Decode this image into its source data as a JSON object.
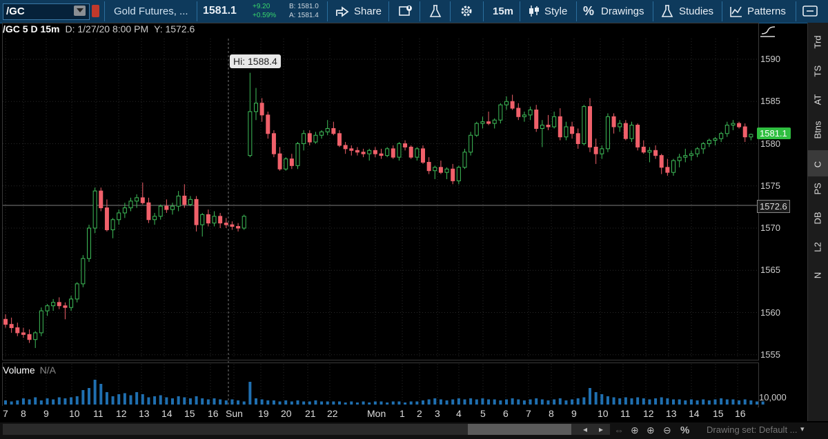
{
  "toolbar": {
    "symbol": "/GC",
    "description": "Gold Futures, ...",
    "last": "1581.1",
    "change": "+9.20",
    "change_pct": "+0.59%",
    "bid": "B: 1581.0",
    "ask": "A: 1581.4",
    "share": "Share",
    "timeframe": "15m",
    "style": "Style",
    "drawings": "Drawings",
    "studies": "Studies",
    "patterns": "Patterns"
  },
  "chart_info": {
    "title": "/GC 5 D 15m",
    "date": "D: 1/27/20 8:00 PM",
    "y": "Y: 1572.6"
  },
  "annotations": {
    "hi": "Hi: 1588.4",
    "last_price": "1581.1",
    "crosshair_price": "1572.6"
  },
  "volume": {
    "label": "Volume",
    "value": "N/A",
    "axis_label": "10,000"
  },
  "side_tabs": [
    "Trd",
    "TS",
    "AT",
    "Btns",
    "C",
    "PS",
    "DB",
    "L2",
    "N"
  ],
  "side_active": "C",
  "drawing_set": "Drawing set: Default ...",
  "colors": {
    "up": "#3fbf5a",
    "down": "#f0606a",
    "volume": "#1f6fb0",
    "toolbar_bg": "#0e3a5c",
    "last_badge": "#2fbf40"
  },
  "chart_data": {
    "type": "candlestick",
    "title": "/GC 5 D 15m",
    "ylim": [
      1554,
      1593
    ],
    "y_ticks": [
      1555,
      1560,
      1565,
      1570,
      1575,
      1580,
      1585,
      1590
    ],
    "x_ticks": [
      "7",
      "8",
      "9",
      "10",
      "11",
      "12",
      "13",
      "14",
      "15",
      "16",
      "Sun",
      "19",
      "20",
      "21",
      "22",
      "Mon",
      "1",
      "2",
      "3",
      "4",
      "5",
      "6",
      "7",
      "8",
      "9",
      "10",
      "11",
      "12",
      "13",
      "14",
      "15",
      "16"
    ],
    "session_break_index": 44,
    "candles": [
      [
        1559.2,
        1559.8,
        1558.2,
        1558.6
      ],
      [
        1558.6,
        1559.4,
        1557.6,
        1558.2
      ],
      [
        1558.2,
        1558.8,
        1557.2,
        1557.6
      ],
      [
        1557.6,
        1558.2,
        1557.0,
        1557.4
      ],
      [
        1557.4,
        1558.0,
        1556.4,
        1556.8
      ],
      [
        1556.8,
        1557.8,
        1555.8,
        1557.6
      ],
      [
        1557.6,
        1560.6,
        1557.2,
        1560.2
      ],
      [
        1560.2,
        1561.0,
        1559.6,
        1560.8
      ],
      [
        1560.8,
        1561.6,
        1560.2,
        1561.2
      ],
      [
        1561.2,
        1561.8,
        1560.4,
        1560.8
      ],
      [
        1560.8,
        1561.2,
        1559.2,
        1560.6
      ],
      [
        1560.6,
        1562.0,
        1560.2,
        1561.6
      ],
      [
        1561.6,
        1563.6,
        1561.2,
        1563.4
      ],
      [
        1563.4,
        1566.8,
        1563.0,
        1566.4
      ],
      [
        1566.4,
        1570.4,
        1566.0,
        1570.0
      ],
      [
        1570.0,
        1574.8,
        1569.4,
        1574.4
      ],
      [
        1574.4,
        1574.8,
        1572.0,
        1572.4
      ],
      [
        1572.4,
        1573.4,
        1569.6,
        1569.8
      ],
      [
        1569.8,
        1571.2,
        1568.8,
        1571.0
      ],
      [
        1571.0,
        1572.2,
        1570.4,
        1571.8
      ],
      [
        1571.8,
        1573.0,
        1571.2,
        1572.4
      ],
      [
        1572.4,
        1573.6,
        1572.0,
        1573.2
      ],
      [
        1573.2,
        1574.0,
        1572.4,
        1573.6
      ],
      [
        1573.6,
        1575.4,
        1572.8,
        1573.0
      ],
      [
        1573.0,
        1573.6,
        1570.6,
        1571.0
      ],
      [
        1571.0,
        1571.8,
        1570.4,
        1571.4
      ],
      [
        1571.4,
        1572.8,
        1571.0,
        1572.6
      ],
      [
        1572.6,
        1573.4,
        1571.8,
        1572.2
      ],
      [
        1572.2,
        1573.0,
        1571.6,
        1572.6
      ],
      [
        1572.6,
        1574.4,
        1572.0,
        1573.8
      ],
      [
        1573.8,
        1575.2,
        1572.4,
        1572.8
      ],
      [
        1572.8,
        1573.8,
        1572.6,
        1573.4
      ],
      [
        1573.4,
        1573.8,
        1569.6,
        1570.4
      ],
      [
        1570.4,
        1571.8,
        1569.0,
        1571.6
      ],
      [
        1571.6,
        1572.2,
        1570.2,
        1570.6
      ],
      [
        1570.6,
        1572.0,
        1570.2,
        1571.4
      ],
      [
        1571.4,
        1571.8,
        1570.0,
        1570.6
      ],
      [
        1570.6,
        1571.2,
        1570.0,
        1570.4
      ],
      [
        1570.4,
        1570.8,
        1569.8,
        1570.2
      ],
      [
        1570.2,
        1570.6,
        1569.6,
        1570.0
      ],
      [
        1570.0,
        1571.6,
        1569.8,
        1571.4
      ],
      [
        1578.6,
        1588.4,
        1578.4,
        1583.8
      ],
      [
        1583.8,
        1586.6,
        1582.8,
        1584.8
      ],
      [
        1584.8,
        1585.4,
        1582.6,
        1583.4
      ],
      [
        1583.4,
        1583.8,
        1580.6,
        1581.2
      ],
      [
        1581.2,
        1581.6,
        1578.4,
        1578.8
      ],
      [
        1578.8,
        1579.6,
        1576.8,
        1577.0
      ],
      [
        1577.0,
        1578.4,
        1576.8,
        1578.2
      ],
      [
        1578.2,
        1578.8,
        1577.0,
        1577.4
      ],
      [
        1577.4,
        1580.2,
        1577.0,
        1580.0
      ],
      [
        1580.0,
        1581.6,
        1579.2,
        1581.2
      ],
      [
        1581.2,
        1581.6,
        1579.8,
        1580.2
      ],
      [
        1580.2,
        1581.4,
        1580.0,
        1581.0
      ],
      [
        1581.0,
        1581.6,
        1580.6,
        1581.4
      ],
      [
        1581.4,
        1582.8,
        1581.0,
        1581.8
      ],
      [
        1581.8,
        1582.6,
        1581.0,
        1581.2
      ],
      [
        1581.2,
        1581.6,
        1579.6,
        1579.8
      ],
      [
        1579.8,
        1580.2,
        1578.8,
        1579.4
      ],
      [
        1579.4,
        1579.8,
        1578.6,
        1579.2
      ],
      [
        1579.2,
        1579.6,
        1578.6,
        1579.0
      ],
      [
        1579.0,
        1579.4,
        1578.4,
        1578.8
      ],
      [
        1578.8,
        1579.4,
        1578.0,
        1579.2
      ],
      [
        1579.2,
        1579.6,
        1578.4,
        1578.8
      ],
      [
        1578.8,
        1579.4,
        1578.2,
        1578.6
      ],
      [
        1578.6,
        1579.6,
        1578.4,
        1579.4
      ],
      [
        1579.4,
        1579.8,
        1578.2,
        1578.4
      ],
      [
        1578.4,
        1580.2,
        1578.0,
        1580.0
      ],
      [
        1580.0,
        1580.4,
        1579.2,
        1579.6
      ],
      [
        1579.6,
        1579.8,
        1578.2,
        1578.4
      ],
      [
        1578.4,
        1579.6,
        1578.0,
        1579.4
      ],
      [
        1579.4,
        1579.8,
        1577.6,
        1577.8
      ],
      [
        1577.8,
        1578.4,
        1576.4,
        1576.8
      ],
      [
        1576.8,
        1577.4,
        1575.8,
        1577.2
      ],
      [
        1577.2,
        1578.0,
        1576.4,
        1576.6
      ],
      [
        1576.6,
        1577.2,
        1575.8,
        1577.0
      ],
      [
        1577.0,
        1577.6,
        1575.2,
        1575.6
      ],
      [
        1575.6,
        1577.4,
        1575.2,
        1577.2
      ],
      [
        1577.2,
        1579.4,
        1577.0,
        1579.0
      ],
      [
        1579.0,
        1581.4,
        1578.6,
        1581.0
      ],
      [
        1581.0,
        1582.6,
        1580.8,
        1582.4
      ],
      [
        1582.4,
        1583.2,
        1581.8,
        1582.6
      ],
      [
        1582.6,
        1583.8,
        1582.2,
        1582.4
      ],
      [
        1582.4,
        1583.0,
        1581.8,
        1582.8
      ],
      [
        1582.8,
        1584.8,
        1582.4,
        1584.6
      ],
      [
        1584.6,
        1585.6,
        1584.0,
        1585.0
      ],
      [
        1585.0,
        1585.8,
        1584.0,
        1584.2
      ],
      [
        1584.2,
        1584.8,
        1582.8,
        1583.2
      ],
      [
        1583.2,
        1583.8,
        1582.6,
        1583.4
      ],
      [
        1583.4,
        1584.4,
        1582.8,
        1584.0
      ],
      [
        1584.0,
        1584.6,
        1581.4,
        1581.8
      ],
      [
        1581.8,
        1582.8,
        1579.6,
        1582.2
      ],
      [
        1582.2,
        1583.4,
        1581.6,
        1582.0
      ],
      [
        1582.0,
        1583.8,
        1581.8,
        1583.2
      ],
      [
        1583.2,
        1584.2,
        1580.4,
        1580.8
      ],
      [
        1580.8,
        1582.6,
        1580.4,
        1582.0
      ],
      [
        1582.0,
        1582.6,
        1580.6,
        1581.2
      ],
      [
        1581.2,
        1581.8,
        1579.4,
        1580.0
      ],
      [
        1580.0,
        1584.6,
        1579.8,
        1584.4
      ],
      [
        1584.4,
        1585.4,
        1579.0,
        1579.6
      ],
      [
        1579.6,
        1580.6,
        1577.6,
        1578.8
      ],
      [
        1578.8,
        1579.8,
        1578.2,
        1579.4
      ],
      [
        1579.4,
        1583.6,
        1579.0,
        1583.2
      ],
      [
        1583.2,
        1583.6,
        1581.2,
        1582.0
      ],
      [
        1582.0,
        1582.8,
        1581.4,
        1582.4
      ],
      [
        1582.4,
        1582.8,
        1580.4,
        1580.6
      ],
      [
        1580.6,
        1582.6,
        1580.2,
        1582.2
      ],
      [
        1582.2,
        1582.4,
        1579.2,
        1579.6
      ],
      [
        1579.6,
        1580.4,
        1578.8,
        1579.0
      ],
      [
        1579.0,
        1579.6,
        1577.8,
        1579.2
      ],
      [
        1579.2,
        1579.8,
        1578.2,
        1578.6
      ],
      [
        1578.6,
        1578.8,
        1576.4,
        1577.2
      ],
      [
        1577.2,
        1578.2,
        1576.2,
        1576.6
      ],
      [
        1576.6,
        1578.2,
        1576.2,
        1578.0
      ],
      [
        1578.0,
        1578.8,
        1577.2,
        1578.4
      ],
      [
        1578.4,
        1579.4,
        1577.8,
        1578.6
      ],
      [
        1578.6,
        1579.2,
        1578.0,
        1578.8
      ],
      [
        1578.8,
        1579.6,
        1578.4,
        1579.4
      ],
      [
        1579.4,
        1580.2,
        1578.8,
        1580.0
      ],
      [
        1580.0,
        1580.6,
        1579.6,
        1580.4
      ],
      [
        1580.4,
        1580.8,
        1579.8,
        1580.6
      ],
      [
        1580.6,
        1581.4,
        1580.2,
        1581.2
      ],
      [
        1581.2,
        1582.6,
        1580.8,
        1582.2
      ],
      [
        1582.2,
        1582.8,
        1581.6,
        1582.4
      ],
      [
        1582.4,
        1582.6,
        1581.8,
        1582.0
      ],
      [
        1582.0,
        1582.4,
        1580.2,
        1580.8
      ],
      [
        1580.8,
        1581.2,
        1580.4,
        1581.1
      ]
    ],
    "volume": [
      4,
      3,
      4,
      6,
      5,
      7,
      4,
      6,
      5,
      7,
      6,
      7,
      8,
      14,
      16,
      24,
      20,
      12,
      8,
      10,
      11,
      9,
      12,
      10,
      7,
      8,
      9,
      7,
      6,
      8,
      7,
      6,
      8,
      6,
      5,
      6,
      5,
      4,
      5,
      4,
      3,
      22,
      6,
      5,
      4,
      4,
      3,
      4,
      3,
      4,
      3,
      3,
      4,
      3,
      3,
      3,
      3,
      2,
      3,
      2,
      3,
      2,
      3,
      3,
      2,
      3,
      3,
      2,
      3,
      3,
      4,
      5,
      6,
      5,
      4,
      5,
      6,
      5,
      6,
      5,
      6,
      5,
      5,
      4,
      5,
      6,
      5,
      4,
      5,
      6,
      5,
      4,
      5,
      6,
      4,
      5,
      6,
      7,
      16,
      12,
      10,
      8,
      7,
      6,
      7,
      6,
      7,
      6,
      5,
      6,
      7,
      6,
      5,
      5,
      4,
      5,
      4,
      5,
      4,
      5,
      6,
      5,
      5,
      4,
      5,
      4,
      3,
      3
    ]
  }
}
